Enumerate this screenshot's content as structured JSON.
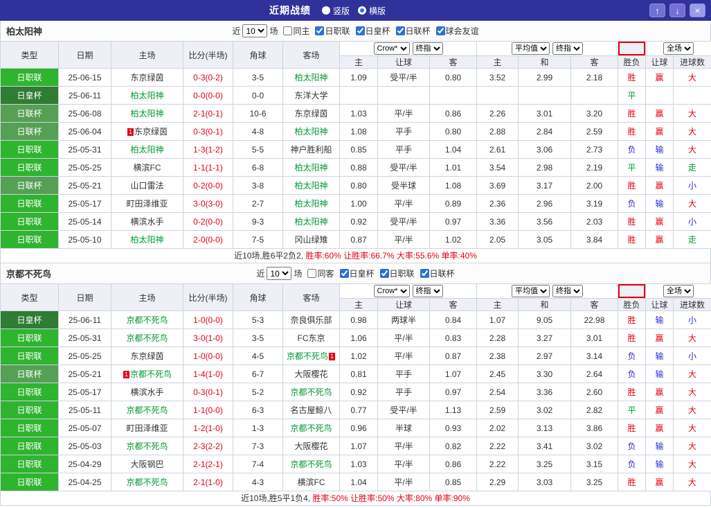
{
  "topbar": {
    "title": "近期战绩",
    "radios": [
      {
        "label": "竖版",
        "selected": false
      },
      {
        "label": "横版",
        "selected": true
      }
    ],
    "buttons": {
      "up": "↑",
      "down": "↓",
      "close": "×"
    }
  },
  "table_header": {
    "left_cols": [
      "类型",
      "日期",
      "主场",
      "比分(半场)",
      "角球",
      "客场"
    ],
    "odds_selects": [
      "Crow*",
      "终指"
    ],
    "avg_selects": [
      "平均值",
      "终指"
    ],
    "scope_select": "全场",
    "sub_cols": [
      "主",
      "让球",
      "客",
      "主",
      "和",
      "客",
      "胜负",
      "让球",
      "进球数"
    ]
  },
  "league_colors": {
    "日职联": "#2fb42f",
    "日皇杯": "#2e7d32",
    "日联杯": "#55a055"
  },
  "text_colors": {
    "red": "#e60012",
    "blue": "#2c2cd8",
    "green": "#009933",
    "dark": "#333333"
  },
  "verdict_colors": {
    "胜": "red",
    "赢": "red",
    "大": "red",
    "负": "blue",
    "输": "blue",
    "小": "blue",
    "平": "green",
    "走": "green"
  },
  "sections": [
    {
      "team": "柏太阳神",
      "filter": {
        "prefix": "近",
        "count": "10",
        "suffix": "场",
        "checkboxes": [
          {
            "label": "同主",
            "checked": false
          },
          {
            "label": "日职联",
            "checked": true
          },
          {
            "label": "日皇杯",
            "checked": true
          },
          {
            "label": "日联杯",
            "checked": true
          },
          {
            "label": "球会友谊",
            "checked": true
          }
        ]
      },
      "rows": [
        {
          "league": "日职联",
          "date": "25-06-15",
          "home": {
            "name": "东京绿茵",
            "focus": false
          },
          "score": "0-3(0-2)",
          "corner": "3-5",
          "away": {
            "name": "柏太阳神",
            "focus": true
          },
          "odds": [
            "1.09",
            "受平/半",
            "0.80"
          ],
          "avg": [
            "3.52",
            "2.99",
            "2.18"
          ],
          "verdicts": [
            "胜",
            "赢",
            "大"
          ]
        },
        {
          "league": "日皇杯",
          "date": "25-06-11",
          "home": {
            "name": "柏太阳神",
            "focus": true
          },
          "score": "0-0(0-0)",
          "corner": "0-0",
          "away": {
            "name": "东洋大学",
            "focus": false
          },
          "odds": [
            "",
            "",
            ""
          ],
          "avg": [
            "",
            "",
            ""
          ],
          "verdicts": [
            "平",
            "",
            ""
          ]
        },
        {
          "league": "日联杯",
          "date": "25-06-08",
          "home": {
            "name": "柏太阳神",
            "focus": true
          },
          "score": "2-1(0-1)",
          "corner": "10-6",
          "away": {
            "name": "东京绿茵",
            "focus": false
          },
          "odds": [
            "1.03",
            "平/半",
            "0.86"
          ],
          "avg": [
            "2.26",
            "3.01",
            "3.20"
          ],
          "verdicts": [
            "胜",
            "赢",
            "大"
          ]
        },
        {
          "league": "日联杯",
          "date": "25-06-04",
          "home": {
            "name": "东京绿茵",
            "focus": false,
            "badge": "1",
            "badge_pos": "before"
          },
          "score": "0-3(0-1)",
          "corner": "4-8",
          "away": {
            "name": "柏太阳神",
            "focus": true
          },
          "odds": [
            "1.08",
            "平手",
            "0.80"
          ],
          "avg": [
            "2.88",
            "2.84",
            "2.59"
          ],
          "verdicts": [
            "胜",
            "赢",
            "大"
          ]
        },
        {
          "league": "日职联",
          "date": "25-05-31",
          "home": {
            "name": "柏太阳神",
            "focus": true
          },
          "score": "1-3(1-2)",
          "corner": "5-5",
          "away": {
            "name": "神户胜利船",
            "focus": false
          },
          "odds": [
            "0.85",
            "平手",
            "1.04"
          ],
          "avg": [
            "2.61",
            "3.06",
            "2.73"
          ],
          "verdicts": [
            "负",
            "输",
            "大"
          ]
        },
        {
          "league": "日职联",
          "date": "25-05-25",
          "home": {
            "name": "横滨FC",
            "focus": false
          },
          "score": "1-1(1-1)",
          "corner": "6-8",
          "away": {
            "name": "柏太阳神",
            "focus": true
          },
          "odds": [
            "0.88",
            "受平/半",
            "1.01"
          ],
          "avg": [
            "3.54",
            "2.98",
            "2.19"
          ],
          "verdicts": [
            "平",
            "输",
            "走"
          ]
        },
        {
          "league": "日联杯",
          "date": "25-05-21",
          "home": {
            "name": "山口雷法",
            "focus": false
          },
          "score": "0-2(0-0)",
          "corner": "3-8",
          "away": {
            "name": "柏太阳神",
            "focus": true
          },
          "odds": [
            "0.80",
            "受半球",
            "1.08"
          ],
          "avg": [
            "3.69",
            "3.17",
            "2.00"
          ],
          "verdicts": [
            "胜",
            "赢",
            "小"
          ]
        },
        {
          "league": "日职联",
          "date": "25-05-17",
          "home": {
            "name": "町田泽维亚",
            "focus": false
          },
          "score": "3-0(3-0)",
          "corner": "2-7",
          "away": {
            "name": "柏太阳神",
            "focus": true
          },
          "odds": [
            "1.00",
            "平/半",
            "0.89"
          ],
          "avg": [
            "2.36",
            "2.96",
            "3.19"
          ],
          "verdicts": [
            "负",
            "输",
            "大"
          ]
        },
        {
          "league": "日职联",
          "date": "25-05-14",
          "home": {
            "name": "横滨水手",
            "focus": false
          },
          "score": "0-2(0-0)",
          "corner": "9-3",
          "away": {
            "name": "柏太阳神",
            "focus": true
          },
          "odds": [
            "0.92",
            "受平/半",
            "0.97"
          ],
          "avg": [
            "3.36",
            "3.56",
            "2.03"
          ],
          "verdicts": [
            "胜",
            "赢",
            "小"
          ]
        },
        {
          "league": "日职联",
          "date": "25-05-10",
          "home": {
            "name": "柏太阳神",
            "focus": true
          },
          "score": "2-0(0-0)",
          "corner": "7-5",
          "away": {
            "name": "冈山绿雉",
            "focus": false
          },
          "odds": [
            "0.87",
            "平/半",
            "1.02"
          ],
          "avg": [
            "2.05",
            "3.05",
            "3.84"
          ],
          "verdicts": [
            "胜",
            "赢",
            "走"
          ]
        }
      ],
      "summary": [
        {
          "text": "近10场,胜6平2负2, ",
          "color": "dark"
        },
        {
          "text": "胜率:60% ",
          "color": "red"
        },
        {
          "text": "让胜率:66.7% ",
          "color": "red"
        },
        {
          "text": "大率:55.6% ",
          "color": "red"
        },
        {
          "text": "单率:40%",
          "color": "red"
        }
      ]
    },
    {
      "team": "京都不死鸟",
      "filter": {
        "prefix": "近",
        "count": "10",
        "suffix": "场",
        "checkboxes": [
          {
            "label": "同客",
            "checked": false
          },
          {
            "label": "日皇杯",
            "checked": true
          },
          {
            "label": "日职联",
            "checked": true
          },
          {
            "label": "日联杯",
            "checked": true
          }
        ]
      },
      "rows": [
        {
          "league": "日皇杯",
          "date": "25-06-11",
          "home": {
            "name": "京都不死鸟",
            "focus": true
          },
          "score": "1-0(0-0)",
          "corner": "5-3",
          "away": {
            "name": "奈良俱乐部",
            "focus": false
          },
          "odds": [
            "0.98",
            "两球半",
            "0.84"
          ],
          "avg": [
            "1.07",
            "9.05",
            "22.98"
          ],
          "verdicts": [
            "胜",
            "输",
            "小"
          ]
        },
        {
          "league": "日职联",
          "date": "25-05-31",
          "home": {
            "name": "京都不死鸟",
            "focus": true
          },
          "score": "3-0(1-0)",
          "corner": "3-5",
          "away": {
            "name": "FC东京",
            "focus": false
          },
          "odds": [
            "1.06",
            "平/半",
            "0.83"
          ],
          "avg": [
            "2.28",
            "3.27",
            "3.01"
          ],
          "verdicts": [
            "胜",
            "赢",
            "大"
          ]
        },
        {
          "league": "日职联",
          "date": "25-05-25",
          "home": {
            "name": "东京绿茵",
            "focus": false
          },
          "score": "1-0(0-0)",
          "corner": "4-5",
          "away": {
            "name": "京都不死鸟",
            "focus": true,
            "badge": "1",
            "badge_pos": "after"
          },
          "odds": [
            "1.02",
            "平/半",
            "0.87"
          ],
          "avg": [
            "2.38",
            "2.97",
            "3.14"
          ],
          "verdicts": [
            "负",
            "输",
            "小"
          ]
        },
        {
          "league": "日联杯",
          "date": "25-05-21",
          "home": {
            "name": "京都不死鸟",
            "focus": true,
            "badge": "1",
            "badge_pos": "before"
          },
          "score": "1-4(1-0)",
          "corner": "6-7",
          "away": {
            "name": "大阪樱花",
            "focus": false
          },
          "odds": [
            "0.81",
            "平手",
            "1.07"
          ],
          "avg": [
            "2.45",
            "3.30",
            "2.64"
          ],
          "verdicts": [
            "负",
            "输",
            "大"
          ]
        },
        {
          "league": "日职联",
          "date": "25-05-17",
          "home": {
            "name": "横滨水手",
            "focus": false
          },
          "score": "0-3(0-1)",
          "corner": "5-2",
          "away": {
            "name": "京都不死鸟",
            "focus": true
          },
          "odds": [
            "0.92",
            "平手",
            "0.97"
          ],
          "avg": [
            "2.54",
            "3.36",
            "2.60"
          ],
          "verdicts": [
            "胜",
            "赢",
            "大"
          ]
        },
        {
          "league": "日职联",
          "date": "25-05-11",
          "home": {
            "name": "京都不死鸟",
            "focus": true
          },
          "score": "1-1(0-0)",
          "corner": "6-3",
          "away": {
            "name": "名古屋鲸八",
            "focus": false
          },
          "odds": [
            "0.77",
            "受平/半",
            "1.13"
          ],
          "avg": [
            "2.59",
            "3.02",
            "2.82"
          ],
          "verdicts": [
            "平",
            "赢",
            "大"
          ]
        },
        {
          "league": "日职联",
          "date": "25-05-07",
          "home": {
            "name": "町田泽维亚",
            "focus": false
          },
          "score": "1-2(1-0)",
          "corner": "1-3",
          "away": {
            "name": "京都不死鸟",
            "focus": true
          },
          "odds": [
            "0.96",
            "半球",
            "0.93"
          ],
          "avg": [
            "2.02",
            "3.13",
            "3.86"
          ],
          "verdicts": [
            "胜",
            "赢",
            "大"
          ]
        },
        {
          "league": "日职联",
          "date": "25-05-03",
          "home": {
            "name": "京都不死鸟",
            "focus": true
          },
          "score": "2-3(2-2)",
          "corner": "7-3",
          "away": {
            "name": "大阪樱花",
            "focus": false
          },
          "odds": [
            "1.07",
            "平/半",
            "0.82"
          ],
          "avg": [
            "2.22",
            "3.41",
            "3.02"
          ],
          "verdicts": [
            "负",
            "输",
            "大"
          ]
        },
        {
          "league": "日职联",
          "date": "25-04-29",
          "home": {
            "name": "大阪钢巴",
            "focus": false
          },
          "score": "2-1(2-1)",
          "corner": "7-4",
          "away": {
            "name": "京都不死鸟",
            "focus": true
          },
          "odds": [
            "1.03",
            "平/半",
            "0.86"
          ],
          "avg": [
            "2.22",
            "3.25",
            "3.15"
          ],
          "verdicts": [
            "负",
            "输",
            "大"
          ]
        },
        {
          "league": "日职联",
          "date": "25-04-25",
          "home": {
            "name": "京都不死鸟",
            "focus": true
          },
          "score": "2-1(1-0)",
          "corner": "4-3",
          "away": {
            "name": "横滨FC",
            "focus": false
          },
          "odds": [
            "1.04",
            "平/半",
            "0.85"
          ],
          "avg": [
            "2.29",
            "3.03",
            "3.25"
          ],
          "verdicts": [
            "胜",
            "赢",
            "大"
          ]
        }
      ],
      "summary": [
        {
          "text": "近10场,胜5平1负4, ",
          "color": "dark"
        },
        {
          "text": "胜率:50% ",
          "color": "red"
        },
        {
          "text": "让胜率:50% ",
          "color": "red"
        },
        {
          "text": "大率:80% ",
          "color": "red"
        },
        {
          "text": "单率:90%",
          "color": "red"
        }
      ]
    }
  ]
}
